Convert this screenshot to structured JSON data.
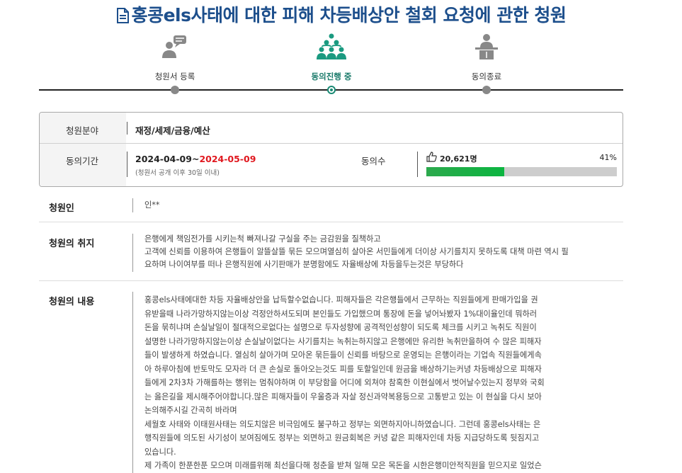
{
  "petition": {
    "title": "홍콩els사태에 대한 피해 차등배상안 철회 요청에 관한 청원"
  },
  "steps": [
    {
      "label": "청원서 등록",
      "icon": "person-speech-icon",
      "active": false
    },
    {
      "label": "동의진행 중",
      "icon": "people-group-icon",
      "active": true
    },
    {
      "label": "동의종료",
      "icon": "podium-speaker-icon",
      "active": false
    }
  ],
  "info": {
    "field_label": "청원분야",
    "field_value": "재정/세제/금융/예산",
    "period_label": "동의기간",
    "period_start": "2024-04-09~",
    "period_end": "2024-05-09",
    "period_note": "(청원서 공개 이후 30일 이내)",
    "consent_label": "동의수",
    "consent_count": "20,621명",
    "consent_percent_text": "41%",
    "consent_fraction": 0.41,
    "bar_color": "#16b044"
  },
  "petitioner": {
    "label": "청원인",
    "value": "인**"
  },
  "purpose": {
    "label": "청원의 취지",
    "lines": [
      "은행에게 책임전가를 시키는척 빠져나갈 구실을 주는 금감원을 질책하고",
      "고객에 신뢰를 이용하여 은행들이 알뜰살뜰 묶든 모으며열심히 살아온 서민들에게 더이상 사기를치지 못하도록 대책 마련 역시 필",
      "요하며 나이여부를 떠나 은행직원에 사기판매가 분명함에도 자율배상에 차등을두는것은 부당하다"
    ]
  },
  "content": {
    "label": "청원의 내용",
    "lines": [
      "홍콩els사태에대한 차등 자율배상안을 납득할수없습니다. 피해자들은 각은행들에서 근무하는 직원들에게 판매가입을 권",
      "유받을때 나라가망하지않는이상 걱정안하셔도되며 본인들도 가입했으며 통장에 돈을 넣어놔봤자 1%대이율인데 뭐하러",
      "돈을 묶히냐며 손실날일이  절대적으로없다는 설명으로 두자성향에 공격적인성향이 되도록 체크를 시키고 녹취도 직원이",
      "설명한 나라가망하지않는이상 손실날이없다는 사기를치는 녹취는하지않고 은행에만 유리한 녹취만을하여 수 많은 피해자",
      "들이 발생하게 하였습니다. 열심히 살아가며 모아온 묶든들이 신뢰를 바탕으로 운영되는 은행이라는 기업속 직원들에게속",
      "아 하루아침에 반토막도 모자라 더 큰 손실로 돌아오는것도 피를 토할일인데 원금을 배상하기는커녕 차등배상으로 피해자",
      "들에게 2차3차 가해를하는 행위는 멈춰야하며 이 부당함을 어디에 외쳐야 참혹한 이현실에서 벗어날수있는지 정부와 국회",
      "는 옳은길을 제시해주어야합니다.많은 피해자들이 우울증과 자살 정신과약복용등으로 고통받고 있는 이 현실을 다시 보아",
      "논의해주시길 간곡히 바라며",
      "세월호 사태와 이태원사태는 의도치않은 비극임에도 불구하고 정부는 외면하지아니하였습니다. 그런데 홍콩els사태는 은",
      "행직원들에 의도된 사기성이 보여짐에도 정부는 외면하고 원금회복은 커녕 같은 피해자인데 차등 지급당하도록 뒷짐지고",
      "있습니다.",
      "제 가족이 한푼한푼 모으며 미래를위해 최선을다해 청춘을 받쳐 일해 모은 목돈을 시한은행미안적직원을 믿으지로 일었슨"
    ]
  }
}
